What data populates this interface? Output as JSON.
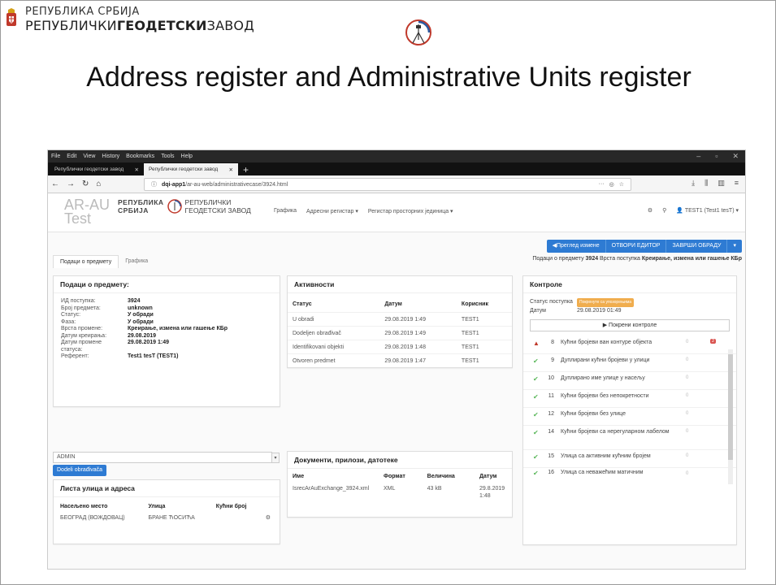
{
  "org": {
    "line1": "РЕПУБЛИКА СРБИЈА",
    "line2_a": "РЕПУБЛИЧКИ",
    "line2_b": "ГЕОДЕТСКИ",
    "line2_c": "ЗАВОД"
  },
  "slide_title": "Address register and Administrative Units register",
  "browser": {
    "menu": [
      "File",
      "Edit",
      "View",
      "History",
      "Bookmarks",
      "Tools",
      "Help"
    ],
    "tabs": [
      {
        "label": "Републички геодетски завод",
        "active": false
      },
      {
        "label": "Републички геодетски завод",
        "active": true
      }
    ],
    "url_host": "dqi-app1",
    "url_path": "/ar-au-web/administrativecase/3924.html",
    "url_more": "···"
  },
  "app": {
    "name": "AR-AU Test",
    "logo_line1": "РЕПУБЛИКА\nСРБИЈА",
    "logo_line2": "РЕПУБЛИЧКИ\nГЕОДЕТСКИ ЗАВОД",
    "nav": [
      "Графика",
      "Адресни регистар ▾",
      "Регистар просторних јединица ▾"
    ],
    "user": "TEST1 (Test1 tesT) ▾",
    "buttons": [
      "◀Преглед измене",
      "ОТВОРИ ЕДИТОР",
      "ЗАВРШИ ОБРАДУ",
      "▾"
    ],
    "case_info": {
      "prefix": "Подаци о предмету ",
      "id": "3924",
      "mid": " Врста поступка ",
      "type": "Креирање, измена или гашење КБр"
    },
    "subtabs": [
      "Подаци о предмету",
      "Графика"
    ]
  },
  "subject": {
    "title": "Подаци о предмету:",
    "rows": [
      {
        "k": "ИД поступка:",
        "v": "3924"
      },
      {
        "k": "Број предмета:",
        "v": "unknown"
      },
      {
        "k": "Статус:",
        "v": "У обради"
      },
      {
        "k": "Фаза:",
        "v": "У обради"
      },
      {
        "k": "Врста промене:",
        "v": "Креирање, измена или гашење КБр"
      },
      {
        "k": "Датум креирања:",
        "v": "29.08.2019"
      },
      {
        "k": "Датум промене",
        "v": "29.08.2019 1:49"
      },
      {
        "k": "статуса:",
        "v": ""
      },
      {
        "k": "Референт:",
        "v": "Test1 tesT (TEST1)"
      }
    ]
  },
  "activities": {
    "title": "Активности",
    "headers": [
      "Статус",
      "Датум",
      "Корисник"
    ],
    "rows": [
      [
        "U obradi",
        "29.08.2019 1:49",
        "TEST1"
      ],
      [
        "Dodeljen obrađivač",
        "29.08.2019 1:49",
        "TEST1"
      ],
      [
        "Identifikovani objekti",
        "29.08.2019 1:48",
        "TEST1"
      ],
      [
        "Otvoren predmet",
        "29.08.2019 1:47",
        "TEST1"
      ]
    ]
  },
  "controls": {
    "title": "Контроле",
    "status_label": "Статус поступка",
    "status_value": "Покренуте са упозорењима",
    "date_label": "Датум",
    "date_value": "29.08.2019 01:49",
    "run_label": "▶ Покрени контроле",
    "rows": [
      {
        "icon": "▲",
        "num": "8",
        "label": "Кућни бројеви ван контуре објекта",
        "count": "0",
        "count2": "2",
        "kind": "warn"
      },
      {
        "icon": "✔",
        "num": "9",
        "label": "Дуплирани кућни бројеви у улици",
        "count": "0",
        "count2": "",
        "kind": "ok"
      },
      {
        "icon": "✔",
        "num": "10",
        "label": "Дуплирано име улице у насељу",
        "count": "0",
        "count2": "",
        "kind": "ok"
      },
      {
        "icon": "✔",
        "num": "11",
        "label": "Кућни бројеви без непокретности",
        "count": "0",
        "count2": "",
        "kind": "ok"
      },
      {
        "icon": "✔",
        "num": "12",
        "label": "Кућни бројеви без улице",
        "count": "0",
        "count2": "",
        "kind": "ok"
      },
      {
        "icon": "✔",
        "num": "14",
        "label": "Кућни бројеви са нерегуларном лабелом",
        "count": "0",
        "count2": "",
        "kind": "ok"
      },
      {
        "icon": "✔",
        "num": "15",
        "label": "Улица са активним кућним бројем",
        "count": "0",
        "count2": "",
        "kind": "ok"
      },
      {
        "icon": "✔",
        "num": "16",
        "label": "Улица са неважећим матичним",
        "count": "0",
        "count2": "",
        "kind": "ok"
      }
    ]
  },
  "admin": {
    "select": "ADMIN",
    "assign_button": "Dodeli obrađivača"
  },
  "streets": {
    "title": "Листа улица и адреса",
    "headers": [
      "Насељено место",
      "Улица",
      "Кућни број"
    ],
    "rows": [
      [
        "БЕОГРАД (ВОЖДОВАЦ)",
        "БРАНЕ ЋОСИЋА",
        ""
      ]
    ]
  },
  "docs": {
    "title": "Документи, прилози, датотеке",
    "headers": [
      "Име",
      "Формат",
      "Величина",
      "Датум"
    ],
    "rows": [
      [
        "IsrecArAuExchange_3924.xml",
        "XML",
        "43 kB",
        "29.8.2019 1:48"
      ]
    ]
  }
}
